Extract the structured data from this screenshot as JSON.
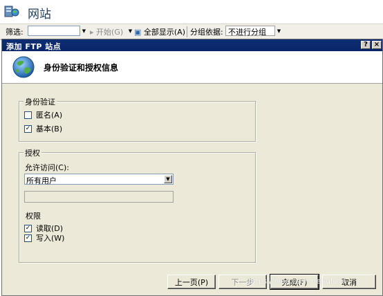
{
  "background": {
    "title": "网站",
    "filter_label": "筛选:",
    "start_label": "开始(G)",
    "show_all_label": "全部显示(A)",
    "group_by_label": "分组依据:",
    "group_by_value": "不进行分组"
  },
  "dialog": {
    "title": "添加 FTP 站点",
    "help_symbol": "?",
    "close_symbol": "×",
    "heading": "身份验证和授权信息",
    "auth": {
      "group_label": "身份验证",
      "anonymous_label": "匿名(A)",
      "anonymous_checked": false,
      "basic_label": "基本(B)",
      "basic_checked": true
    },
    "authorization": {
      "group_label": "授权",
      "allow_access_label": "允许访问(C):",
      "allow_access_value": "所有用户",
      "permissions_label": "权限",
      "read_label": "读取(D)",
      "read_checked": true,
      "write_label": "写入(W)",
      "write_checked": true
    },
    "buttons": {
      "previous": "上一页(P)",
      "next": "下一步",
      "finish": "完成(F)",
      "cancel": "取消"
    },
    "watermark": "https://blog.csdn.net/ululul"
  },
  "colors": {
    "titlebar": "#0a246a",
    "dialog_bg": "#ece9d8",
    "header_bg": "#ffffff"
  }
}
